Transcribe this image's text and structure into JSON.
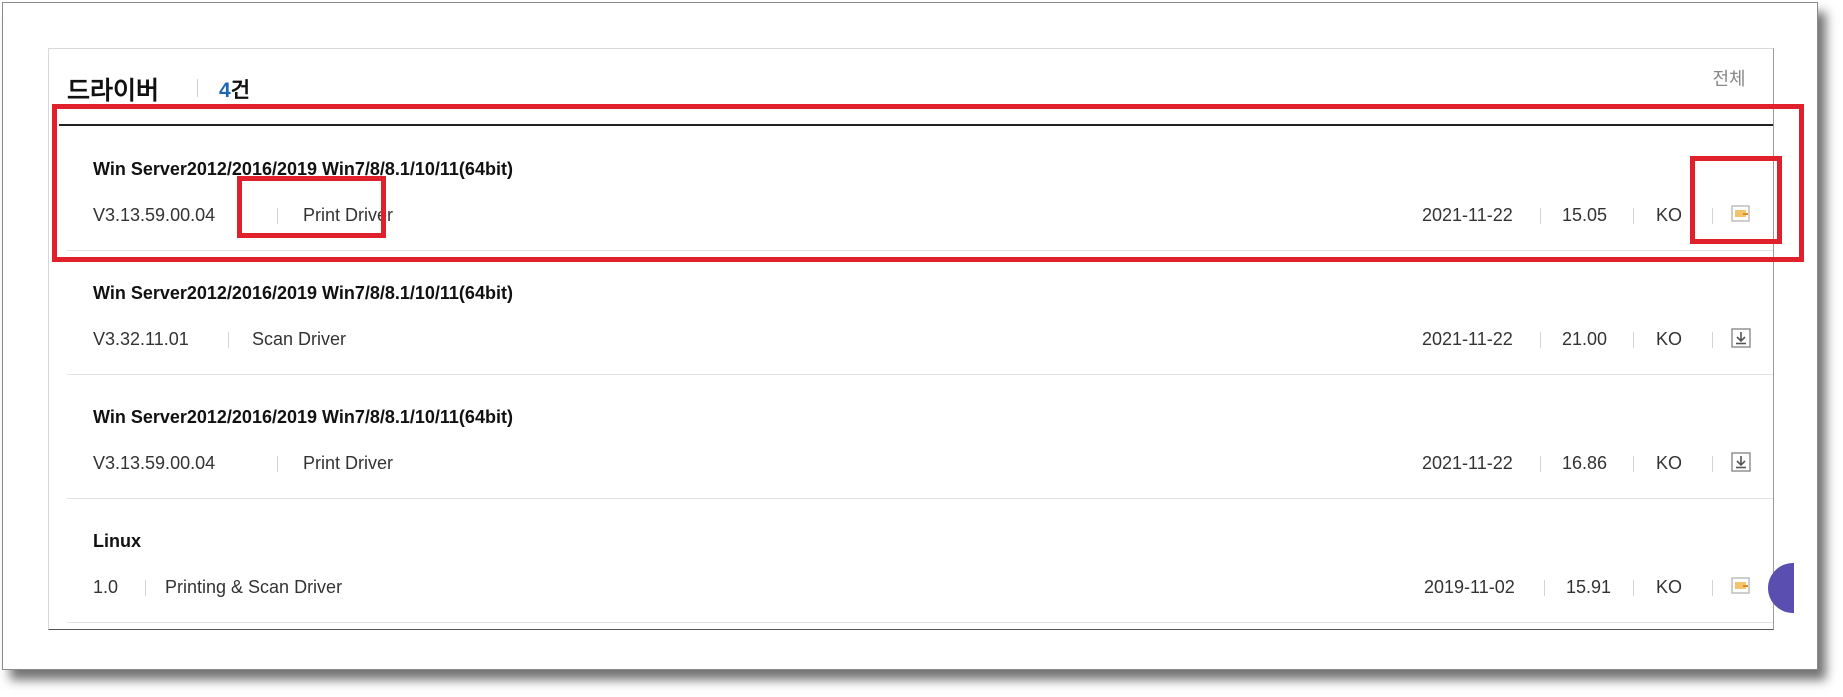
{
  "section": {
    "title": "드라이버",
    "count_num": "4",
    "count_unit": "건",
    "filter_label": "전체"
  },
  "drivers": [
    {
      "name": "Win Server2012/2016/2019 Win7/8/8.1/10/11(64bit)",
      "version": "V3.13.59.00.04",
      "type": "Print Driver",
      "date": "2021-11-22",
      "size": "15.05",
      "lang": "KO",
      "icon": "document-icon"
    },
    {
      "name": "Win Server2012/2016/2019 Win7/8/8.1/10/11(64bit)",
      "version": "V3.32.11.01",
      "type": "Scan Driver",
      "date": "2021-11-22",
      "size": "21.00",
      "lang": "KO",
      "icon": "download-icon"
    },
    {
      "name": "Win Server2012/2016/2019 Win7/8/8.1/10/11(64bit)",
      "version": "V3.13.59.00.04",
      "type": "Print Driver",
      "date": "2021-11-22",
      "size": "16.86",
      "lang": "KO",
      "icon": "download-icon"
    },
    {
      "name": "Linux",
      "version": "1.0",
      "type": "Printing & Scan Driver",
      "date": "2019-11-02",
      "size": "15.91",
      "lang": "KO",
      "icon": "document-icon"
    }
  ],
  "colors": {
    "accent": "#1e66b8",
    "highlight": "#e0202a",
    "document_icon": "#f0b84a"
  }
}
